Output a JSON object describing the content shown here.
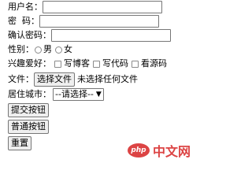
{
  "form": {
    "username": {
      "label": "用户名：",
      "value": ""
    },
    "password": {
      "label": "密  码：",
      "value": ""
    },
    "confirm": {
      "label": "确认密码：",
      "value": ""
    },
    "gender": {
      "label": "性别：",
      "options": [
        "男",
        "女"
      ]
    },
    "hobbies": {
      "label": "兴趣爱好：",
      "options": [
        "写博客",
        "写代码",
        "看源码"
      ]
    },
    "file": {
      "label": "文件：",
      "button": "选择文件",
      "status": "未选择任何文件"
    },
    "city": {
      "label": "居住城市：",
      "selected": "--请选择--"
    },
    "buttons": {
      "submit": "提交按钮",
      "normal": "普通按钮",
      "reset": "重置"
    }
  },
  "watermark": {
    "logo": "php",
    "text": "中文网"
  },
  "colors": {
    "watermark": "#d93030"
  }
}
